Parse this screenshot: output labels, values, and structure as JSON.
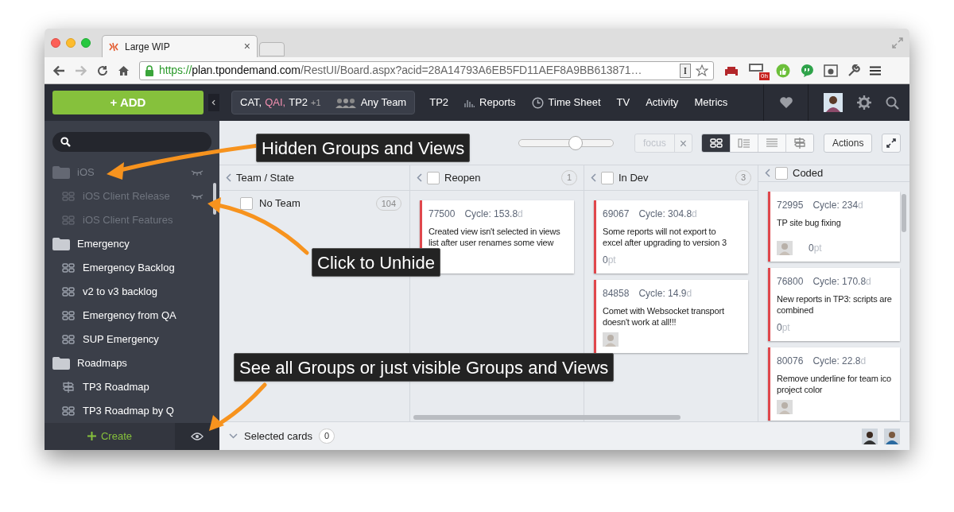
{
  "browser": {
    "tab_title": "Large WIP",
    "tab_close": "×",
    "url": {
      "scheme": "https://",
      "host": "plan.tpondemand.com",
      "path": "/RestUI/Board.aspx?acid=28A14793A6EB5FD11AEF8A9BB613871…"
    },
    "reader_key": "I",
    "badge": "0h"
  },
  "header": {
    "add_label": "+ ADD",
    "projects": [
      {
        "name": "CAT,",
        "color": "#ffffff"
      },
      {
        "name": "QAI,",
        "color": "#f28fb0"
      },
      {
        "name": "TP2",
        "color": "#ffffff"
      }
    ],
    "more": "+1",
    "team": "Any Team",
    "nav": [
      {
        "label": "TP2",
        "kind": "plain"
      },
      {
        "label": "Reports",
        "kind": "chart"
      },
      {
        "label": "Time Sheet",
        "kind": "clock"
      },
      {
        "label": "TV",
        "kind": "plain"
      },
      {
        "label": "Activity",
        "kind": "plain"
      },
      {
        "label": "Metrics",
        "kind": "plain"
      }
    ]
  },
  "sidebar": {
    "groups": [
      {
        "name": "iOS",
        "hidden": true,
        "children": [
          {
            "name": "iOS Client Release",
            "kind": "board",
            "hidden": true
          },
          {
            "name": "iOS Client Features",
            "kind": "board",
            "hidden": true
          }
        ]
      },
      {
        "name": "Emergency",
        "hidden": false,
        "children": [
          {
            "name": "Emergency Backlog",
            "kind": "board",
            "hidden": false
          },
          {
            "name": "v2 to v3 backlog",
            "kind": "board",
            "hidden": false
          },
          {
            "name": "Emergency from QA",
            "kind": "board",
            "hidden": false
          },
          {
            "name": "SUP Emergency",
            "kind": "board",
            "hidden": false
          }
        ]
      },
      {
        "name": "Roadmaps",
        "hidden": false,
        "children": [
          {
            "name": "TP3 Roadmap",
            "kind": "roadmap",
            "hidden": false
          },
          {
            "name": "TP3 Roadmap by Q",
            "kind": "board",
            "hidden": false
          }
        ]
      }
    ],
    "create_label": "Create",
    "show_hidden": true
  },
  "toolbar": {
    "zoom": {
      "level": 0.6
    },
    "focus": "focus",
    "focus_clear": "×",
    "views": [
      {
        "kind": "grid",
        "selected": true
      },
      {
        "kind": "list",
        "selected": false
      },
      {
        "kind": "rows",
        "selected": false
      },
      {
        "kind": "roadmap",
        "selected": false
      }
    ],
    "actions": "Actions"
  },
  "axis": {
    "title": "Team / State",
    "rows": [
      {
        "name": "No Team",
        "count": "104",
        "checked": false
      }
    ]
  },
  "columns": [
    {
      "title": "Reopen",
      "count": "1",
      "checked": false,
      "cards": [
        {
          "id": "77500",
          "cycle": "Cycle: 153.8",
          "unit": "d",
          "lines": [
            "Created view isn't selected in views",
            "list after user renames some view"
          ],
          "avatar": false
        }
      ]
    },
    {
      "title": "In Dev",
      "count": "3",
      "checked": false,
      "cards": [
        {
          "id": "69067",
          "cycle": "Cycle: 304.8",
          "unit": "d",
          "lines": [
            "Some reports will not export to",
            "excel after upgrading to version 3"
          ],
          "points": "0",
          "points_unit": "pt",
          "avatar": false
        },
        {
          "id": "84858",
          "cycle": "Cycle: 14.9",
          "unit": "d",
          "lines": [
            "Comet with Websocket transport",
            "doesn't work at all!!!"
          ],
          "avatar": true
        }
      ]
    },
    {
      "title": "Coded",
      "checked": false,
      "cards": [
        {
          "id": "72995",
          "cycle": "Cycle: 234",
          "unit": "d",
          "lines": [
            "TP site bug fixing"
          ],
          "points": "0",
          "points_unit": "pt",
          "avatar": true
        },
        {
          "id": "76800",
          "cycle": "Cycle: 170.8",
          "unit": "d",
          "lines": [
            "New reports in TP3: scripts are",
            "combined"
          ],
          "points": "0",
          "points_unit": "pt",
          "avatar": false
        },
        {
          "id": "80076",
          "cycle": "Cycle: 22.8",
          "unit": "d",
          "lines": [
            "Remove underline for team ico",
            "project color"
          ],
          "avatar": true
        }
      ]
    }
  ],
  "selected": {
    "label": "Selected cards",
    "count": "0"
  },
  "callouts": [
    "Hidden Groups and Views",
    "Click to Unhide",
    "See all Groups or just visible Groups and Views"
  ]
}
